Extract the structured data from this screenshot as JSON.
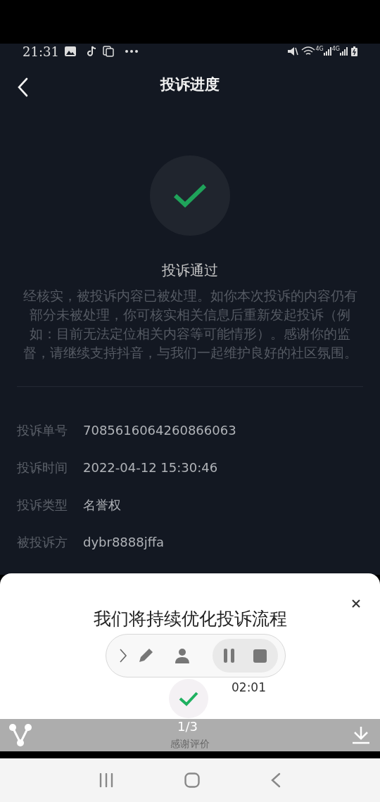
{
  "status_bar": {
    "time": "21:31",
    "network_1": "4G",
    "network_2": "4G"
  },
  "header": {
    "title": "投诉进度"
  },
  "result": {
    "title": "投诉通过",
    "message": "经核实，被投诉内容已被处理。如你本次投诉的内容仍有部分未被处理，你可核实相关信息后重新发起投诉（例如：目前无法定位相关内容等可能情形）。感谢你的监督，请继续支持抖音，与我们一起维护良好的社区氛围。"
  },
  "details": [
    {
      "label": "投诉单号",
      "value": "7085616064260866063"
    },
    {
      "label": "投诉时间",
      "value": "2022-04-12 15:30:46"
    },
    {
      "label": "投诉类型",
      "value": "名誉权"
    },
    {
      "label": "被投诉方",
      "value": "dybr8888jffa"
    }
  ],
  "sheet": {
    "title": "我们将持续优化投诉流程"
  },
  "recorder": {
    "timer": "02:01"
  },
  "viewer_bar": {
    "counter": "1/3",
    "caption": "感谢评价"
  }
}
